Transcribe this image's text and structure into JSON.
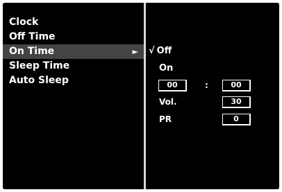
{
  "menu": {
    "items": [
      {
        "label": "Clock"
      },
      {
        "label": "Off Time"
      },
      {
        "label": "On Time",
        "arrow": "►"
      },
      {
        "label": "Sleep Time"
      },
      {
        "label": "Auto Sleep"
      }
    ],
    "selected_index": 2
  },
  "submenu": {
    "options": {
      "off_label": "Off",
      "off_check": "√",
      "on_label": "On"
    },
    "time": {
      "hour": "00",
      "separator": ":",
      "minute": "00"
    },
    "volume": {
      "label": "Vol.",
      "value": "30"
    },
    "programme": {
      "label": "PR",
      "value": "0"
    }
  },
  "colors": {
    "background": "#000000",
    "highlight": "#444444",
    "text": "#ffffff",
    "divider": "#d8d8d8"
  }
}
